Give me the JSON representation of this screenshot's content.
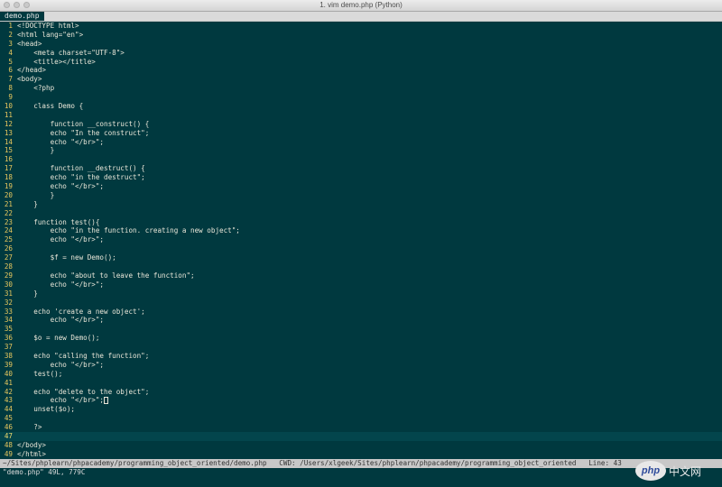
{
  "window": {
    "title": "1. vim demo.php (Python)"
  },
  "tab": {
    "label": "demo.php"
  },
  "editor": {
    "cursor_line": 47,
    "lines": [
      {
        "n": "1",
        "text": "<!DOCTYPE html>"
      },
      {
        "n": "2",
        "text": "<html lang=\"en\">"
      },
      {
        "n": "3",
        "text": "<head>"
      },
      {
        "n": "4",
        "text": "    <meta charset=\"UTF-8\">"
      },
      {
        "n": "5",
        "text": "    <title></title>"
      },
      {
        "n": "6",
        "text": "</head>"
      },
      {
        "n": "7",
        "text": "<body>"
      },
      {
        "n": "8",
        "text": "    <?php"
      },
      {
        "n": "9",
        "text": ""
      },
      {
        "n": "10",
        "text": "    class Demo {"
      },
      {
        "n": "11",
        "text": ""
      },
      {
        "n": "12",
        "text": "        function __construct() {"
      },
      {
        "n": "13",
        "text": "        echo \"In the construct\";"
      },
      {
        "n": "14",
        "text": "        echo \"</br>\";"
      },
      {
        "n": "15",
        "text": "        }"
      },
      {
        "n": "16",
        "text": ""
      },
      {
        "n": "17",
        "text": "        function __destruct() {"
      },
      {
        "n": "18",
        "text": "        echo \"in the destruct\";"
      },
      {
        "n": "19",
        "text": "        echo \"</br>\";"
      },
      {
        "n": "20",
        "text": "        }"
      },
      {
        "n": "21",
        "text": "    }"
      },
      {
        "n": "22",
        "text": ""
      },
      {
        "n": "23",
        "text": "    function test(){"
      },
      {
        "n": "24",
        "text": "        echo \"in the function. creating a new object\";"
      },
      {
        "n": "25",
        "text": "        echo \"</br>\";"
      },
      {
        "n": "26",
        "text": ""
      },
      {
        "n": "27",
        "text": "        $f = new Demo();"
      },
      {
        "n": "28",
        "text": ""
      },
      {
        "n": "29",
        "text": "        echo \"about to leave the function\";"
      },
      {
        "n": "30",
        "text": "        echo \"</br>\";"
      },
      {
        "n": "31",
        "text": "    }"
      },
      {
        "n": "32",
        "text": ""
      },
      {
        "n": "33",
        "text": "    echo 'create a new object';"
      },
      {
        "n": "34",
        "text": "        echo \"</br>\";"
      },
      {
        "n": "35",
        "text": ""
      },
      {
        "n": "36",
        "text": "    $o = new Demo();"
      },
      {
        "n": "37",
        "text": ""
      },
      {
        "n": "38",
        "text": "    echo \"calling the function\";"
      },
      {
        "n": "39",
        "text": "        echo \"</br>\";"
      },
      {
        "n": "40",
        "text": "    test();"
      },
      {
        "n": "41",
        "text": ""
      },
      {
        "n": "42",
        "text": "    echo \"delete to the object\";"
      },
      {
        "n": "43",
        "text": "        echo \"</br>\";"
      },
      {
        "n": "44",
        "text": "    unset($o);"
      },
      {
        "n": "45",
        "text": ""
      },
      {
        "n": "46",
        "text": "    ?>"
      },
      {
        "n": "47",
        "text": ""
      },
      {
        "n": "48",
        "text": "</body>"
      },
      {
        "n": "49",
        "text": "</html>"
      }
    ]
  },
  "statusline": {
    "text": "~/Sites/phplearn/phpacademy/programming_object_oriented/demo.php   CWD: /Users/xlgeek/Sites/phplearn/phpacademy/programming_object_oriented   Line: 43"
  },
  "cmdline": {
    "text": "\"demo.php\" 49L, 779C"
  },
  "watermark": {
    "logo": "php",
    "text": "中文网"
  },
  "colors": {
    "background": "#00393f",
    "line_number": "#e8c85e",
    "code_text": "#e9e6d8",
    "statusline_bg": "#c8c8c8"
  }
}
